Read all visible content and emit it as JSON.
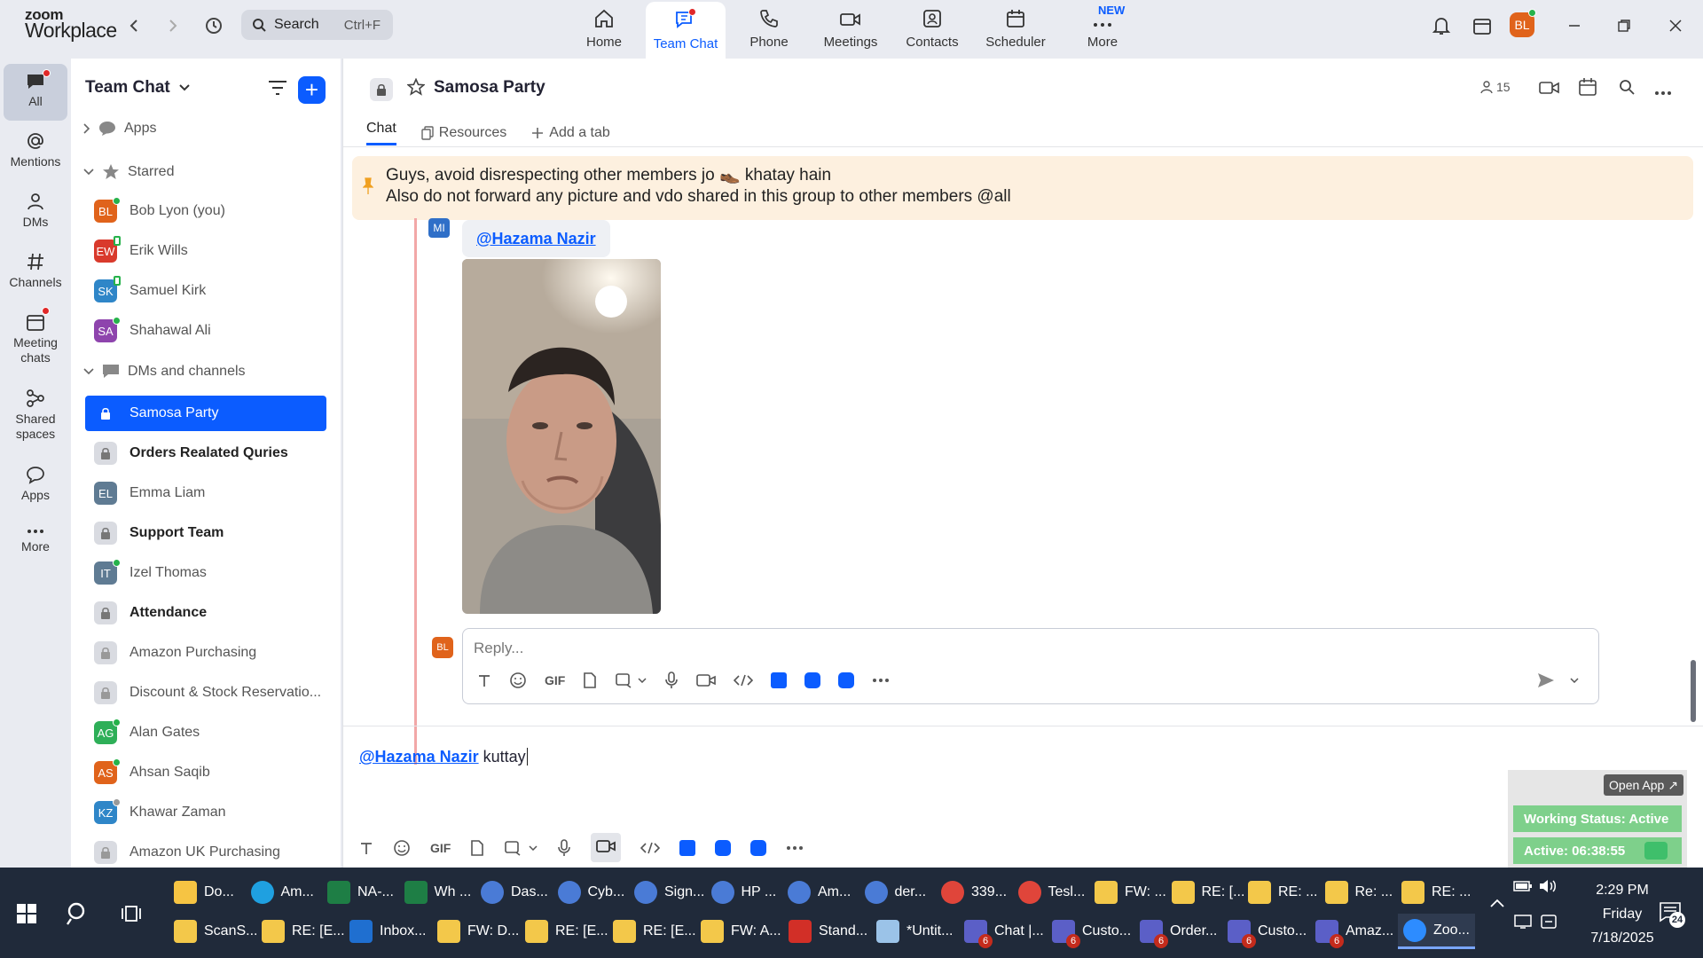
{
  "app": {
    "logo_line1": "zoom",
    "logo_line2": "Workplace"
  },
  "search": {
    "placeholder": "Search",
    "shortcut": "Ctrl+F"
  },
  "nav_tabs": [
    {
      "label": "Home",
      "icon": "home-icon"
    },
    {
      "label": "Team Chat",
      "icon": "chat-icon",
      "active": true
    },
    {
      "label": "Phone",
      "icon": "phone-icon"
    },
    {
      "label": "Meetings",
      "icon": "video-icon"
    },
    {
      "label": "Contacts",
      "icon": "contacts-icon"
    },
    {
      "label": "Scheduler",
      "icon": "calendar-icon"
    },
    {
      "label": "More",
      "icon": "more-icon",
      "badge": "NEW"
    }
  ],
  "user": {
    "initials": "BL",
    "color": "#e0631b"
  },
  "rail": [
    {
      "label": "All",
      "active": true
    },
    {
      "label": "Mentions"
    },
    {
      "label": "DMs"
    },
    {
      "label": "Channels"
    },
    {
      "label": "Meeting chats"
    },
    {
      "label": "Shared spaces"
    },
    {
      "label": "Apps"
    },
    {
      "label": "More"
    }
  ],
  "sidebar": {
    "title": "Team Chat",
    "apps_label": "Apps",
    "starred_label": "Starred",
    "starred": [
      {
        "initials": "BL",
        "name": "Bob Lyon (you)",
        "color": "#e0631b",
        "status": "green"
      },
      {
        "initials": "EW",
        "name": "Erik Wills",
        "color": "#d93a2c",
        "status": "hollow"
      },
      {
        "initials": "SK",
        "name": "Samuel Kirk",
        "color": "#2f86c8",
        "status": "hollow"
      },
      {
        "initials": "SA",
        "name": "Shahawal Ali",
        "color": "#8e44ad",
        "status": "green"
      }
    ],
    "dms_label": "DMs and channels",
    "channels": [
      {
        "type": "lock",
        "name": "Samosa Party",
        "selected": true
      },
      {
        "type": "lock",
        "name": "Orders Realated Quries",
        "bold": true
      },
      {
        "type": "avatar",
        "initials": "EL",
        "name": "Emma Liam",
        "color": "#5f7b93"
      },
      {
        "type": "lock",
        "name": "Support Team",
        "bold": true
      },
      {
        "type": "avatar",
        "initials": "IT",
        "name": "Izel Thomas",
        "color": "#5f7b93",
        "status": "green"
      },
      {
        "type": "lock",
        "name": "Attendance",
        "bold": true
      },
      {
        "type": "lock",
        "name": "Amazon Purchasing"
      },
      {
        "type": "lock",
        "name": "Discount & Stock Reservatio..."
      },
      {
        "type": "avatar",
        "initials": "AG",
        "name": "Alan Gates",
        "color": "#2eaf58",
        "status": "green"
      },
      {
        "type": "avatar",
        "initials": "AS",
        "name": "Ahsan Saqib",
        "color": "#e0631b",
        "status": "green"
      },
      {
        "type": "avatar",
        "initials": "KZ",
        "name": "Khawar Zaman",
        "color": "#2f86c8",
        "status": "grey"
      },
      {
        "type": "lock",
        "name": "Amazon UK Purchasing"
      }
    ]
  },
  "channel": {
    "name": "Samosa Party",
    "members": "15",
    "tabs": [
      "Chat",
      "Resources",
      "Add a tab"
    ],
    "pinned_line1": "Guys, avoid disrespecting other members jo",
    "pinned_line1_end": "khatay hain",
    "pinned_line2": "Also do not forward any picture and vdo shared in this group to other members @all",
    "thread_avatar": "MI",
    "mention": "@Hazama Nazir",
    "reply_placeholder": "Reply...",
    "reply_avatar": "BL"
  },
  "composer": {
    "mention": "@Hazama Nazir",
    "text": "kuttay",
    "gif": "GIF"
  },
  "status_widget": {
    "open_app": "Open App ↗",
    "working_status": "Working Status: Active",
    "active_timer": "Active: 06:38:55"
  },
  "taskbar": {
    "row1": [
      {
        "label": "Do...",
        "color": "#f6c443"
      },
      {
        "label": "Am...",
        "color": "#1fa0e0",
        "circle": true
      },
      {
        "label": "NA-...",
        "color": "#1e7e45"
      },
      {
        "label": "Wh ...",
        "color": "#1e7e45"
      },
      {
        "label": "Das...",
        "color": "#4a7bd6",
        "circle": true
      },
      {
        "label": "Cyb...",
        "color": "#4a7bd6",
        "circle": true
      },
      {
        "label": "Sign...",
        "color": "#4a7bd6",
        "circle": true
      },
      {
        "label": "HP ...",
        "color": "#4a7bd6",
        "circle": true
      },
      {
        "label": "Am...",
        "color": "#4a7bd6",
        "circle": true
      },
      {
        "label": "der...",
        "color": "#4a7bd6",
        "circle": true
      },
      {
        "label": "339...",
        "color": "#e0453a",
        "circle": true
      },
      {
        "label": "Tesl...",
        "color": "#e0453a",
        "circle": true
      },
      {
        "label": "FW: ...",
        "color": "#f3c84a"
      },
      {
        "label": "RE: [...",
        "color": "#f3c84a"
      },
      {
        "label": "RE: ...",
        "color": "#f3c84a"
      },
      {
        "label": "Re: ...",
        "color": "#f3c84a"
      },
      {
        "label": "RE: ...",
        "color": "#f3c84a"
      }
    ],
    "row2": [
      {
        "label": "ScanS...",
        "color": "#f3c84a"
      },
      {
        "label": "RE: [E...",
        "color": "#f3c84a"
      },
      {
        "label": "Inbox...",
        "color": "#1f6fd0"
      },
      {
        "label": "FW: D...",
        "color": "#f3c84a"
      },
      {
        "label": "RE: [E...",
        "color": "#f3c84a"
      },
      {
        "label": "RE: [E...",
        "color": "#f3c84a"
      },
      {
        "label": "FW: A...",
        "color": "#f3c84a"
      },
      {
        "label": "Stand...",
        "color": "#d22f27"
      },
      {
        "label": "*Untit...",
        "color": "#9bc3e8"
      },
      {
        "label": "Chat |...",
        "color": "#5b5fc7",
        "badge": "6"
      },
      {
        "label": "Custo...",
        "color": "#5b5fc7",
        "badge": "6"
      },
      {
        "label": "Order...",
        "color": "#5b5fc7",
        "badge": "6"
      },
      {
        "label": "Custo...",
        "color": "#5b5fc7",
        "badge": "6"
      },
      {
        "label": "Amaz...",
        "color": "#5b5fc7",
        "badge": "6"
      },
      {
        "label": "Zoo...",
        "color": "#2d8cff",
        "circle": true,
        "active": true
      }
    ],
    "time": "2:29 PM",
    "day": "Friday",
    "date": "7/18/2025",
    "notifications": "24"
  }
}
